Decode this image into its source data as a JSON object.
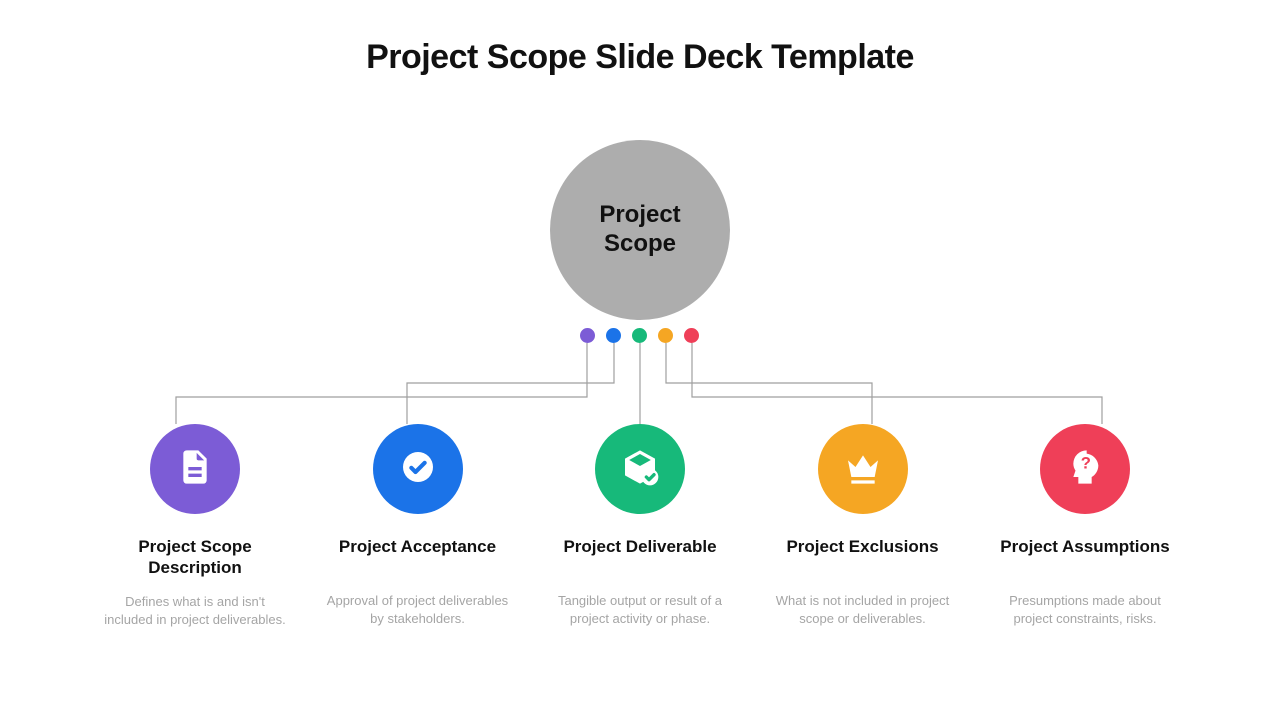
{
  "title": "Project Scope Slide Deck Template",
  "center": {
    "label": "Project\nScope"
  },
  "colors": {
    "purple": "#7c5cd6",
    "blue": "#1b73e8",
    "green": "#17b97a",
    "orange": "#f5a623",
    "red": "#ef3f58",
    "grey": "#adadad"
  },
  "items": [
    {
      "colorKey": "purple",
      "icon": "document-icon",
      "title": "Project Scope Description",
      "desc": "Defines what is and isn't included in project deliverables."
    },
    {
      "colorKey": "blue",
      "icon": "check-circle-icon",
      "title": "Project Acceptance",
      "desc": "Approval of project deliverables by stakeholders."
    },
    {
      "colorKey": "green",
      "icon": "package-check-icon",
      "title": "Project Deliverable",
      "desc": "Tangible output or result of a project activity or phase."
    },
    {
      "colorKey": "orange",
      "icon": "crown-icon",
      "title": "Project Exclusions",
      "desc": "What is not included in project scope or deliverables."
    },
    {
      "colorKey": "red",
      "icon": "head-question-icon",
      "title": "Project Assumptions",
      "desc": "Presumptions made about project constraints, risks."
    }
  ]
}
